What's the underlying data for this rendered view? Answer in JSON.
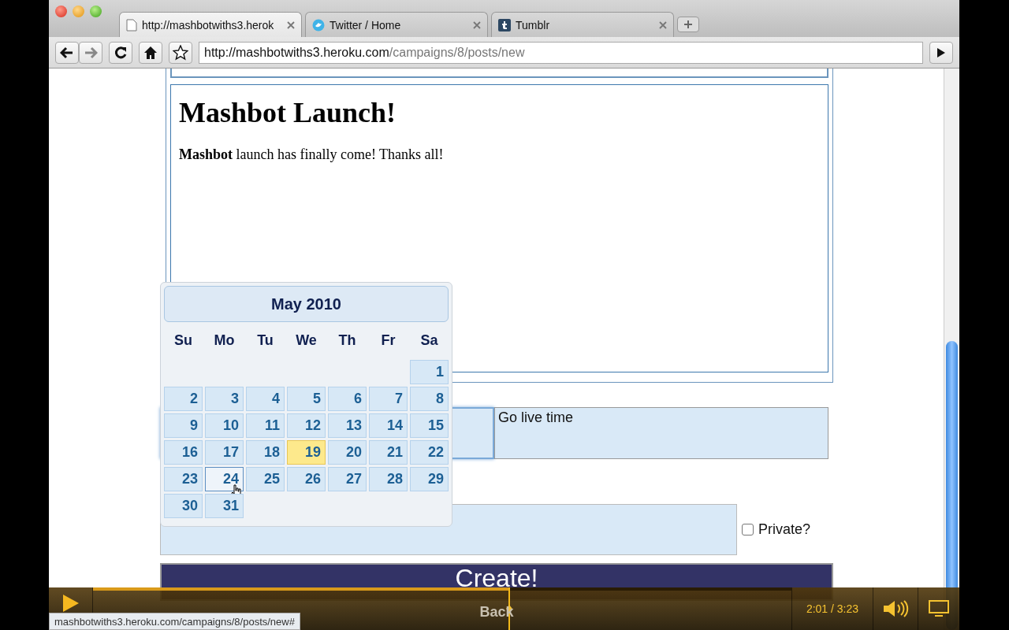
{
  "browser": {
    "tabs": [
      {
        "title": "http://mashbotwiths3.herok",
        "selected": true
      },
      {
        "title": "Twitter / Home",
        "selected": false
      },
      {
        "title": "Tumblr",
        "selected": false
      }
    ],
    "address": {
      "host": "http://mashbotwiths3.heroku.com",
      "path": "/campaigns/8/posts/new"
    },
    "status_url": "mashbotwiths3.heroku.com/campaigns/8/posts/new#"
  },
  "preview": {
    "heading": "Mashbot Launch!",
    "body": "**Mashbot** launch has finally come! Thanks all!"
  },
  "calendar": {
    "title": "May 2010",
    "weekdays": [
      "Su",
      "Mo",
      "Tu",
      "We",
      "Th",
      "Fr",
      "Sa"
    ],
    "weeks": [
      [
        {
          "day": "1",
          "today": false,
          "hovered": false
        }
      ],
      [
        {
          "day": "2",
          "today": false,
          "hovered": false
        },
        {
          "day": "3",
          "today": false,
          "hovered": false
        },
        {
          "day": "4",
          "today": false,
          "hovered": false
        },
        {
          "day": "5",
          "today": false,
          "hovered": false
        },
        {
          "day": "6",
          "today": false,
          "hovered": false
        },
        {
          "day": "7",
          "today": false,
          "hovered": false
        },
        {
          "day": "8",
          "today": false,
          "hovered": false
        }
      ],
      [
        {
          "day": "9",
          "today": false,
          "hovered": false
        },
        {
          "day": "10",
          "today": false,
          "hovered": false
        },
        {
          "day": "11",
          "today": false,
          "hovered": false
        },
        {
          "day": "12",
          "today": false,
          "hovered": false
        },
        {
          "day": "13",
          "today": false,
          "hovered": false
        },
        {
          "day": "14",
          "today": false,
          "hovered": false
        },
        {
          "day": "15",
          "today": false,
          "hovered": false
        }
      ],
      [
        {
          "day": "16",
          "today": false,
          "hovered": false
        },
        {
          "day": "17",
          "today": false,
          "hovered": false
        },
        {
          "day": "18",
          "today": false,
          "hovered": false
        },
        {
          "day": "19",
          "today": true,
          "hovered": false
        },
        {
          "day": "20",
          "today": false,
          "hovered": false
        },
        {
          "day": "21",
          "today": false,
          "hovered": false
        },
        {
          "day": "22",
          "today": false,
          "hovered": false
        }
      ],
      [
        {
          "day": "23",
          "today": false,
          "hovered": false
        },
        {
          "day": "24",
          "today": false,
          "hovered": true
        },
        {
          "day": "25",
          "today": false,
          "hovered": false
        },
        {
          "day": "26",
          "today": false,
          "hovered": false
        },
        {
          "day": "27",
          "today": false,
          "hovered": false
        },
        {
          "day": "28",
          "today": false,
          "hovered": false
        },
        {
          "day": "29",
          "today": false,
          "hovered": false
        }
      ],
      [
        {
          "day": "30",
          "today": false,
          "hovered": false
        },
        {
          "day": "31",
          "today": false,
          "hovered": false
        }
      ]
    ]
  },
  "form": {
    "go_live_label": "Go live time",
    "private": {
      "label": "Private?",
      "checked": false
    },
    "create": "Create!",
    "back": "Back"
  },
  "player": {
    "time": "2:01 / 3:23",
    "level": 0.596
  }
}
